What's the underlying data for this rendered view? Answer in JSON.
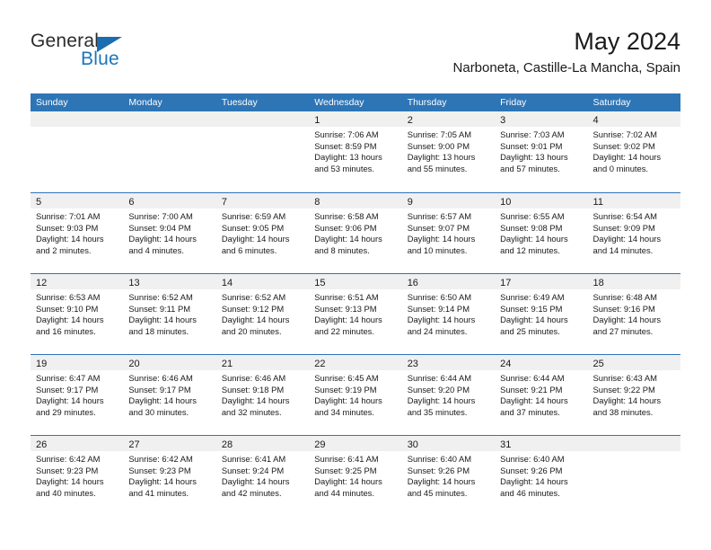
{
  "brand": {
    "name_part1": "General",
    "name_part2": "Blue",
    "accent_color": "#1b6cb0"
  },
  "header": {
    "title": "May 2024",
    "subtitle": "Narboneta, Castille-La Mancha, Spain"
  },
  "theme": {
    "header_bar_color": "#2e75b6",
    "daynum_strip_color": "#f0f0f0",
    "text_color": "#1a1a1a"
  },
  "weekday_headers": [
    "Sunday",
    "Monday",
    "Tuesday",
    "Wednesday",
    "Thursday",
    "Friday",
    "Saturday"
  ],
  "weeks": [
    [
      {
        "day": "",
        "empty": true,
        "sunrise": "",
        "sunset": "",
        "daylight_line1": "",
        "daylight_line2": ""
      },
      {
        "day": "",
        "empty": true,
        "sunrise": "",
        "sunset": "",
        "daylight_line1": "",
        "daylight_line2": ""
      },
      {
        "day": "",
        "empty": true,
        "sunrise": "",
        "sunset": "",
        "daylight_line1": "",
        "daylight_line2": ""
      },
      {
        "day": "1",
        "empty": false,
        "sunrise": "Sunrise: 7:06 AM",
        "sunset": "Sunset: 8:59 PM",
        "daylight_line1": "Daylight: 13 hours",
        "daylight_line2": "and 53 minutes."
      },
      {
        "day": "2",
        "empty": false,
        "sunrise": "Sunrise: 7:05 AM",
        "sunset": "Sunset: 9:00 PM",
        "daylight_line1": "Daylight: 13 hours",
        "daylight_line2": "and 55 minutes."
      },
      {
        "day": "3",
        "empty": false,
        "sunrise": "Sunrise: 7:03 AM",
        "sunset": "Sunset: 9:01 PM",
        "daylight_line1": "Daylight: 13 hours",
        "daylight_line2": "and 57 minutes."
      },
      {
        "day": "4",
        "empty": false,
        "sunrise": "Sunrise: 7:02 AM",
        "sunset": "Sunset: 9:02 PM",
        "daylight_line1": "Daylight: 14 hours",
        "daylight_line2": "and 0 minutes."
      }
    ],
    [
      {
        "day": "5",
        "empty": false,
        "sunrise": "Sunrise: 7:01 AM",
        "sunset": "Sunset: 9:03 PM",
        "daylight_line1": "Daylight: 14 hours",
        "daylight_line2": "and 2 minutes."
      },
      {
        "day": "6",
        "empty": false,
        "sunrise": "Sunrise: 7:00 AM",
        "sunset": "Sunset: 9:04 PM",
        "daylight_line1": "Daylight: 14 hours",
        "daylight_line2": "and 4 minutes."
      },
      {
        "day": "7",
        "empty": false,
        "sunrise": "Sunrise: 6:59 AM",
        "sunset": "Sunset: 9:05 PM",
        "daylight_line1": "Daylight: 14 hours",
        "daylight_line2": "and 6 minutes."
      },
      {
        "day": "8",
        "empty": false,
        "sunrise": "Sunrise: 6:58 AM",
        "sunset": "Sunset: 9:06 PM",
        "daylight_line1": "Daylight: 14 hours",
        "daylight_line2": "and 8 minutes."
      },
      {
        "day": "9",
        "empty": false,
        "sunrise": "Sunrise: 6:57 AM",
        "sunset": "Sunset: 9:07 PM",
        "daylight_line1": "Daylight: 14 hours",
        "daylight_line2": "and 10 minutes."
      },
      {
        "day": "10",
        "empty": false,
        "sunrise": "Sunrise: 6:55 AM",
        "sunset": "Sunset: 9:08 PM",
        "daylight_line1": "Daylight: 14 hours",
        "daylight_line2": "and 12 minutes."
      },
      {
        "day": "11",
        "empty": false,
        "sunrise": "Sunrise: 6:54 AM",
        "sunset": "Sunset: 9:09 PM",
        "daylight_line1": "Daylight: 14 hours",
        "daylight_line2": "and 14 minutes."
      }
    ],
    [
      {
        "day": "12",
        "empty": false,
        "sunrise": "Sunrise: 6:53 AM",
        "sunset": "Sunset: 9:10 PM",
        "daylight_line1": "Daylight: 14 hours",
        "daylight_line2": "and 16 minutes."
      },
      {
        "day": "13",
        "empty": false,
        "sunrise": "Sunrise: 6:52 AM",
        "sunset": "Sunset: 9:11 PM",
        "daylight_line1": "Daylight: 14 hours",
        "daylight_line2": "and 18 minutes."
      },
      {
        "day": "14",
        "empty": false,
        "sunrise": "Sunrise: 6:52 AM",
        "sunset": "Sunset: 9:12 PM",
        "daylight_line1": "Daylight: 14 hours",
        "daylight_line2": "and 20 minutes."
      },
      {
        "day": "15",
        "empty": false,
        "sunrise": "Sunrise: 6:51 AM",
        "sunset": "Sunset: 9:13 PM",
        "daylight_line1": "Daylight: 14 hours",
        "daylight_line2": "and 22 minutes."
      },
      {
        "day": "16",
        "empty": false,
        "sunrise": "Sunrise: 6:50 AM",
        "sunset": "Sunset: 9:14 PM",
        "daylight_line1": "Daylight: 14 hours",
        "daylight_line2": "and 24 minutes."
      },
      {
        "day": "17",
        "empty": false,
        "sunrise": "Sunrise: 6:49 AM",
        "sunset": "Sunset: 9:15 PM",
        "daylight_line1": "Daylight: 14 hours",
        "daylight_line2": "and 25 minutes."
      },
      {
        "day": "18",
        "empty": false,
        "sunrise": "Sunrise: 6:48 AM",
        "sunset": "Sunset: 9:16 PM",
        "daylight_line1": "Daylight: 14 hours",
        "daylight_line2": "and 27 minutes."
      }
    ],
    [
      {
        "day": "19",
        "empty": false,
        "sunrise": "Sunrise: 6:47 AM",
        "sunset": "Sunset: 9:17 PM",
        "daylight_line1": "Daylight: 14 hours",
        "daylight_line2": "and 29 minutes."
      },
      {
        "day": "20",
        "empty": false,
        "sunrise": "Sunrise: 6:46 AM",
        "sunset": "Sunset: 9:17 PM",
        "daylight_line1": "Daylight: 14 hours",
        "daylight_line2": "and 30 minutes."
      },
      {
        "day": "21",
        "empty": false,
        "sunrise": "Sunrise: 6:46 AM",
        "sunset": "Sunset: 9:18 PM",
        "daylight_line1": "Daylight: 14 hours",
        "daylight_line2": "and 32 minutes."
      },
      {
        "day": "22",
        "empty": false,
        "sunrise": "Sunrise: 6:45 AM",
        "sunset": "Sunset: 9:19 PM",
        "daylight_line1": "Daylight: 14 hours",
        "daylight_line2": "and 34 minutes."
      },
      {
        "day": "23",
        "empty": false,
        "sunrise": "Sunrise: 6:44 AM",
        "sunset": "Sunset: 9:20 PM",
        "daylight_line1": "Daylight: 14 hours",
        "daylight_line2": "and 35 minutes."
      },
      {
        "day": "24",
        "empty": false,
        "sunrise": "Sunrise: 6:44 AM",
        "sunset": "Sunset: 9:21 PM",
        "daylight_line1": "Daylight: 14 hours",
        "daylight_line2": "and 37 minutes."
      },
      {
        "day": "25",
        "empty": false,
        "sunrise": "Sunrise: 6:43 AM",
        "sunset": "Sunset: 9:22 PM",
        "daylight_line1": "Daylight: 14 hours",
        "daylight_line2": "and 38 minutes."
      }
    ],
    [
      {
        "day": "26",
        "empty": false,
        "sunrise": "Sunrise: 6:42 AM",
        "sunset": "Sunset: 9:23 PM",
        "daylight_line1": "Daylight: 14 hours",
        "daylight_line2": "and 40 minutes."
      },
      {
        "day": "27",
        "empty": false,
        "sunrise": "Sunrise: 6:42 AM",
        "sunset": "Sunset: 9:23 PM",
        "daylight_line1": "Daylight: 14 hours",
        "daylight_line2": "and 41 minutes."
      },
      {
        "day": "28",
        "empty": false,
        "sunrise": "Sunrise: 6:41 AM",
        "sunset": "Sunset: 9:24 PM",
        "daylight_line1": "Daylight: 14 hours",
        "daylight_line2": "and 42 minutes."
      },
      {
        "day": "29",
        "empty": false,
        "sunrise": "Sunrise: 6:41 AM",
        "sunset": "Sunset: 9:25 PM",
        "daylight_line1": "Daylight: 14 hours",
        "daylight_line2": "and 44 minutes."
      },
      {
        "day": "30",
        "empty": false,
        "sunrise": "Sunrise: 6:40 AM",
        "sunset": "Sunset: 9:26 PM",
        "daylight_line1": "Daylight: 14 hours",
        "daylight_line2": "and 45 minutes."
      },
      {
        "day": "31",
        "empty": false,
        "sunrise": "Sunrise: 6:40 AM",
        "sunset": "Sunset: 9:26 PM",
        "daylight_line1": "Daylight: 14 hours",
        "daylight_line2": "and 46 minutes."
      },
      {
        "day": "",
        "empty": true,
        "sunrise": "",
        "sunset": "",
        "daylight_line1": "",
        "daylight_line2": ""
      }
    ]
  ]
}
